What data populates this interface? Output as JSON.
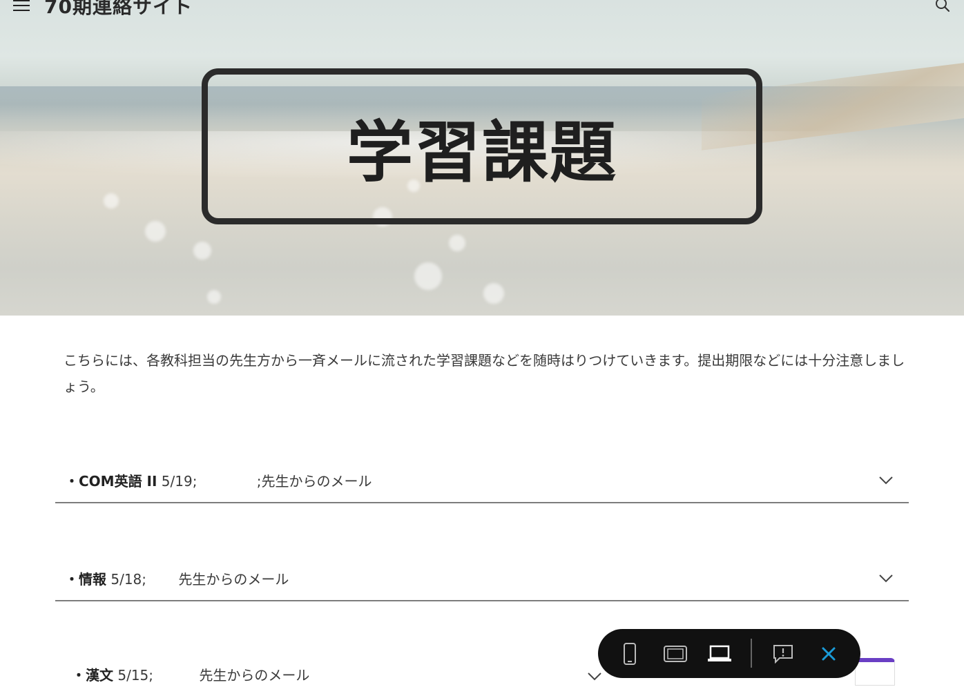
{
  "header": {
    "site_title": "70期連絡サイト",
    "menu_icon": "menu-icon",
    "search_icon": "search-icon"
  },
  "hero": {
    "title": "学習課題"
  },
  "intro": {
    "text": "こちらには、各教科担当の先生方から一斉メールに流された学習課題などを随時はりつけていきます。提出期限などには十分注意しましょう。"
  },
  "accordion": [
    {
      "subject": "・COM英語 II",
      "detail": " 5/19;　　　　 ;先生からのメール"
    },
    {
      "subject": "・情報",
      "detail": " 5/18;　　 先生からのメール"
    },
    {
      "subject": "・漢文",
      "detail": "  5/15;　　　 先生からのメール"
    }
  ],
  "toolbar": {
    "icons": [
      "phone-icon",
      "tablet-icon",
      "laptop-icon",
      "feedback-icon",
      "close-icon"
    ],
    "active_color": "#ffffff",
    "close_color": "#1a9bd8"
  },
  "colors": {
    "accent_purple": "#6a3fc4"
  }
}
